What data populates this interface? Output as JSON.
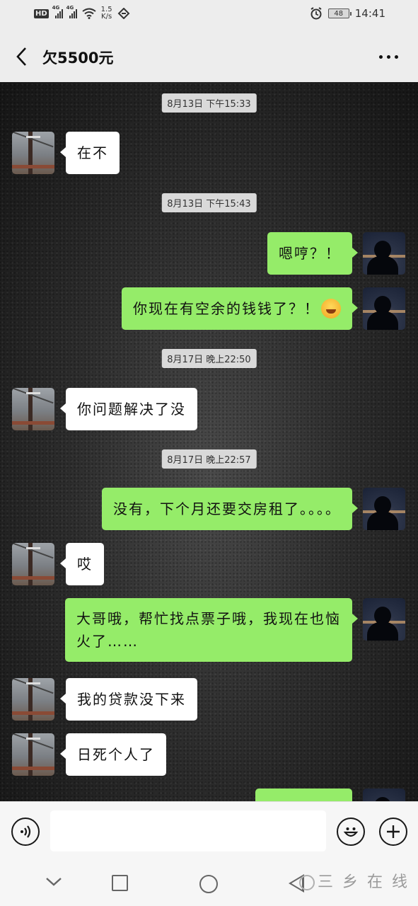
{
  "status_bar": {
    "left_badge": "HD",
    "signal_labels": [
      "4G",
      "4G"
    ],
    "net_speed_value": "1.5",
    "net_speed_unit": "K/s",
    "battery": "48",
    "time": "14:41",
    "icons": [
      "hd-icon",
      "signal-icon",
      "signal-icon",
      "wifi-icon",
      "nfc-icon",
      "alarm-icon",
      "battery-icon"
    ]
  },
  "header": {
    "title": "欠5500元",
    "back_icon": "chevron-left-icon",
    "more_icon": "more-dots-icon"
  },
  "chat": {
    "timestamps": [
      "8月13日 下午15:33",
      "8月13日 下午15:43",
      "8月17日 晚上22:50",
      "8月17日 晚上22:57"
    ],
    "messages": [
      {
        "side": "left",
        "text": "在不"
      },
      {
        "side": "right",
        "text": "嗯哼？！"
      },
      {
        "side": "right",
        "text": "你现在有空余的钱钱了？！",
        "emoji": "laughing-tears-emoji"
      },
      {
        "side": "left",
        "text": "你问题解决了没"
      },
      {
        "side": "right",
        "text": "没有，下个月还要交房租了。。。。"
      },
      {
        "side": "left",
        "text": "哎"
      },
      {
        "side": "right",
        "text": "大哥哦，帮忙找点票子哦，我现在也恼火了……"
      },
      {
        "side": "left",
        "text": "我的贷款没下来"
      },
      {
        "side": "left",
        "text": "日死个人了"
      },
      {
        "side": "right",
        "text": ""
      }
    ]
  },
  "input_bar": {
    "voice_icon": "voice-icon",
    "input_value": "",
    "emoji_icon": "emoji-face-icon",
    "plus_icon": "plus-icon"
  },
  "nav_bar": {
    "icons": [
      "chevron-down-icon",
      "recent-apps-icon",
      "home-icon",
      "back-triangle-icon"
    ],
    "watermark": "三 乡 在 线"
  },
  "colors": {
    "sent_bubble": "#95ec69",
    "received_bubble": "#ffffff",
    "chrome": "#ededed"
  }
}
